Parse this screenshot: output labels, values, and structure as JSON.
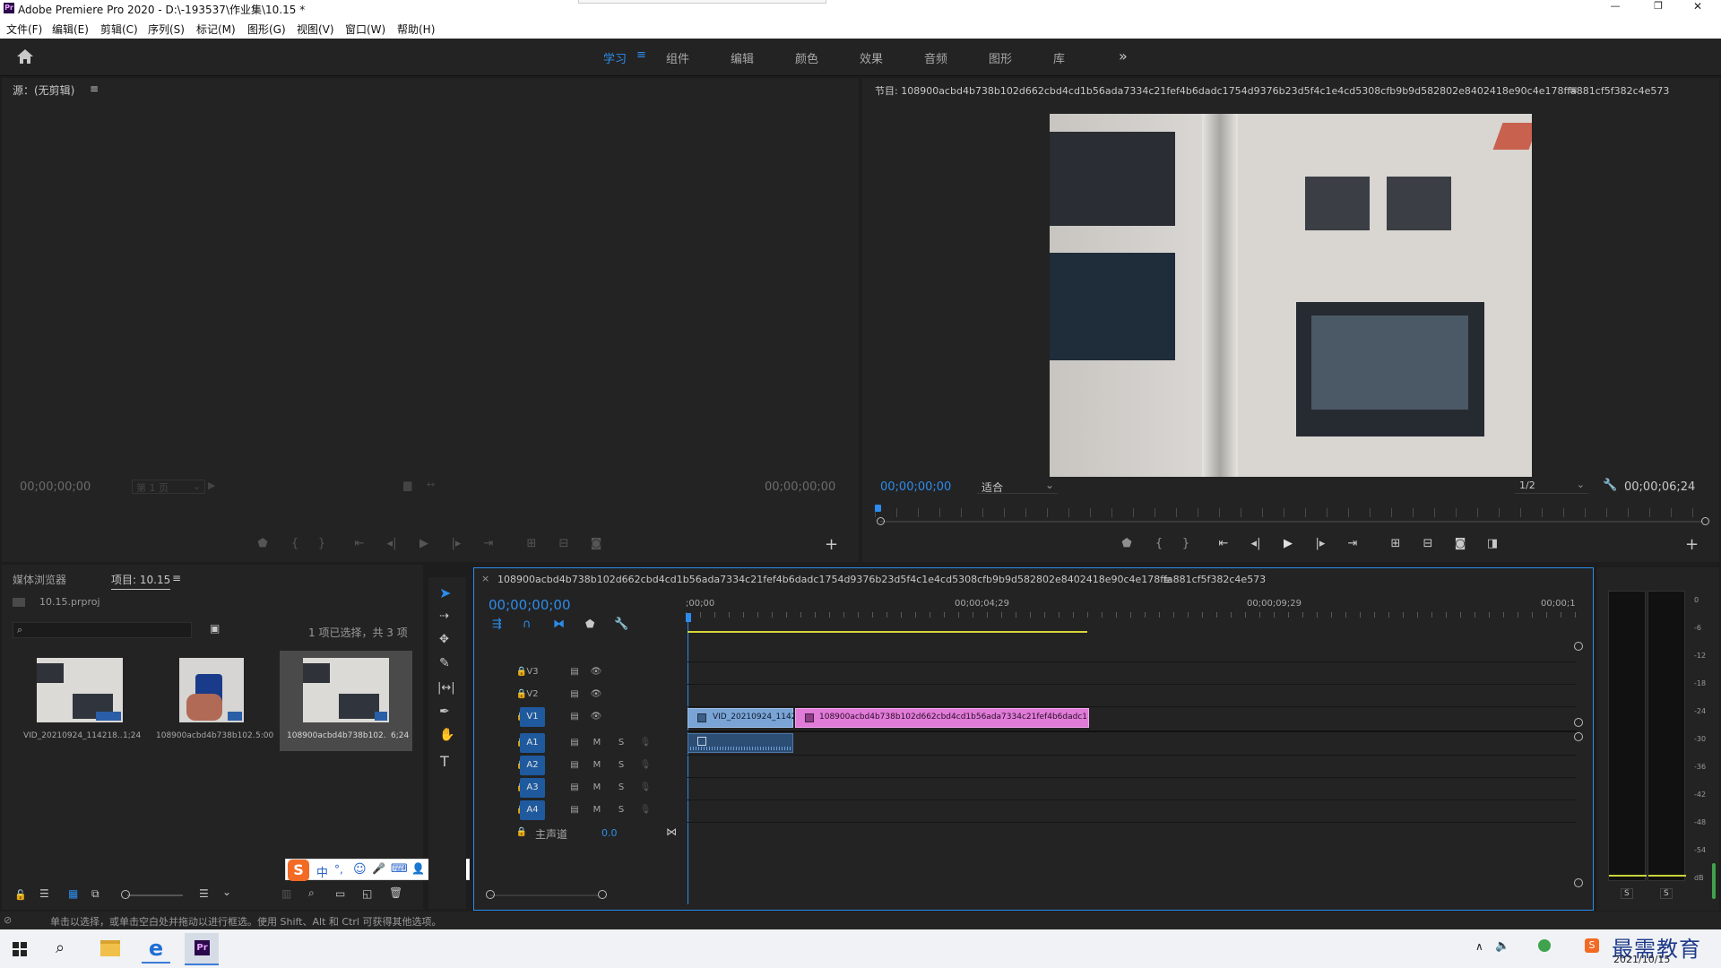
{
  "window": {
    "app_icon": "Pr",
    "title": "Adobe Premiere Pro 2020 - D:\\-193537\\作业集\\10.15 *",
    "controls": {
      "minimize": "—",
      "restore": "❐",
      "close": "✕"
    }
  },
  "menu": [
    "文件(F)",
    "编辑(E)",
    "剪辑(C)",
    "序列(S)",
    "标记(M)",
    "图形(G)",
    "视图(V)",
    "窗口(W)",
    "帮助(H)"
  ],
  "workspaces": {
    "tabs": [
      "学习",
      "组件",
      "编辑",
      "颜色",
      "效果",
      "音频",
      "图形",
      "库"
    ],
    "active": "学习",
    "menu_glyph": "≡",
    "more": "»"
  },
  "source_monitor": {
    "title": "源：(无剪辑)",
    "menu_glyph": "≡",
    "timecode_left": "00;00;00;00",
    "page_select": "第 1 页",
    "timecode_right": "00;00;00;00"
  },
  "program_monitor": {
    "title": "节目: 108900acbd4b738b102d662cbd4cd1b56ada7334c21fef4b6dadc1754d9376b23d5f4c1e4cd5308cfb9b9d582802e8402418e90c4e178ffa881cf5f382c4e573",
    "menu_glyph": "≡",
    "timecode": "00;00;00;00",
    "fit": "适合",
    "resolution": "1/2",
    "duration": "00;00;06;24"
  },
  "project_panel": {
    "tab_media_browser": "媒体浏览器",
    "tab_project": "项目: 10.15",
    "menu_glyph": "≡",
    "project_file": "10.15.prproj",
    "search_placeholder": "",
    "selection_info": "1 项已选择，共 3 项",
    "items": [
      {
        "name": "VID_20210924_114218...",
        "duration": "1;24",
        "selected": false
      },
      {
        "name": "108900acbd4b738b102...",
        "duration": "5:00",
        "selected": false
      },
      {
        "name": "108900acbd4b738b102...",
        "duration": "6;24",
        "selected": true
      }
    ]
  },
  "ime_toolbar": {
    "items": [
      "中",
      "°,",
      "☺",
      "🎤",
      "⌨",
      "👤",
      "👕",
      "▦"
    ]
  },
  "timeline": {
    "sequence_name": "108900acbd4b738b102d662cbd4cd1b56ada7334c21fef4b6dadc1754d9376b23d5f4c1e4cd5308cfb9b9d582802e8402418e90c4e178ffa881cf5f382c4e573",
    "menu_glyph": "≡",
    "close_glyph": "×",
    "timecode": "00;00;00;00",
    "ruler": [
      ";00;00",
      "00;00;04;29",
      "00;00;09;29",
      "00;00;1"
    ],
    "video_tracks": [
      "V3",
      "V2",
      "V1"
    ],
    "audio_tracks": [
      "A1",
      "A2",
      "A3",
      "A4"
    ],
    "master_label": "主声道",
    "master_value": "0.0",
    "m_label": "M",
    "s_label": "S",
    "clips": {
      "v1_clip1": "VID_20210924_1142",
      "v1_clip2": "108900acbd4b738b102d662cbd4cd1b56ada7334c21fef4b6dadc1754d93"
    }
  },
  "audio_meter": {
    "scale": [
      "0",
      "-6",
      "-12",
      "-18",
      "-24",
      "-30",
      "-36",
      "-42",
      "-48",
      "-54",
      "dB"
    ],
    "solo_left": "S",
    "solo_right": "S"
  },
  "status_bar": "单击以选择，或单击空白处并拖动以进行框选。使用 Shift、Alt 和 Ctrl 可获得其他选项。",
  "taskbar": {
    "date": "2021/10/15",
    "watermark": "最需教育",
    "pinned": [
      "windows-start",
      "search",
      "file-explorer",
      "edge",
      "premiere"
    ]
  },
  "colors": {
    "accent_blue": "#2d8ceb",
    "clip_blue": "#7aa4d6",
    "clip_pink": "#e07bd8",
    "work_area_yellow": "#d7d43a",
    "premiere_purple": "#2a0a4a"
  }
}
